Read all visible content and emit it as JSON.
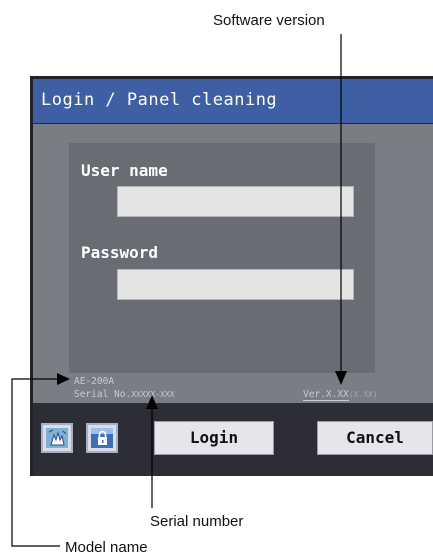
{
  "callouts": {
    "software_version": "Software version",
    "serial_number": "Serial number",
    "model_name": "Model name"
  },
  "screen": {
    "title": "Login / Panel cleaning",
    "user_name_label": "User name",
    "password_label": "Password",
    "user_name_value": "",
    "password_value": "",
    "model": "AE-200A",
    "serial_prefix": "Serial No.",
    "serial_value": "XXXXX-XXX",
    "version_prefix": "Ver.",
    "version_main": "X.XX",
    "version_sub": "(X.XX)",
    "buttons": {
      "login": "Login",
      "cancel": "Cancel"
    },
    "icons": {
      "cleaning": "panel-cleaning-icon",
      "lock": "lock-icon"
    }
  }
}
